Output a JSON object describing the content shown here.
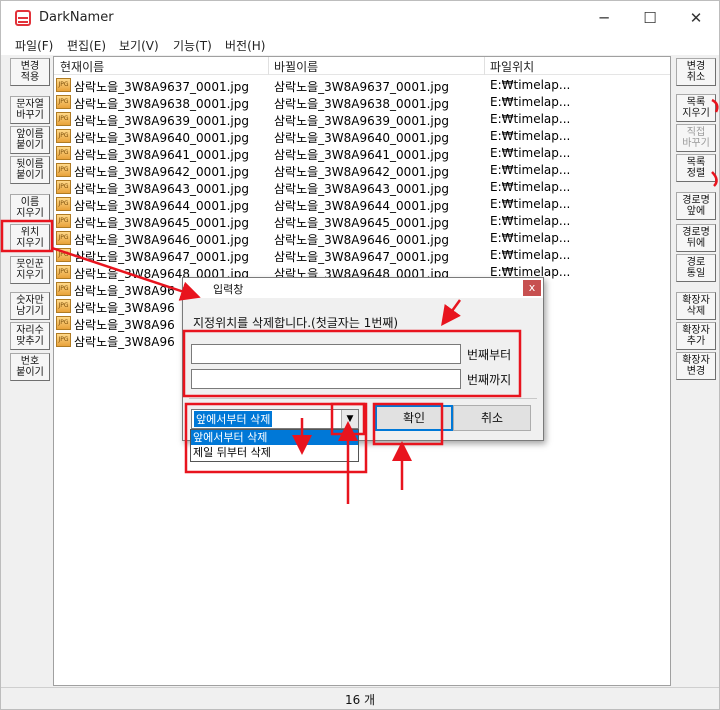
{
  "window": {
    "title": "DarkNamer",
    "controls": [
      "─",
      "☐",
      "✕"
    ]
  },
  "menu": [
    "파일(F)",
    "편집(E)",
    "보기(V)",
    "기능(T)",
    "버전(H)"
  ],
  "left_toolbar": [
    {
      "label": "변경\n적용"
    },
    {
      "label": "문자열\n바꾸기"
    },
    {
      "label": "앞이름\n붙이기"
    },
    {
      "label": "뒷이름\n붙이기"
    },
    {
      "label": "이름\n지우기"
    },
    {
      "label": "위치\n지우기"
    },
    {
      "label": "뭇인꾼\n지우기"
    },
    {
      "label": "숫자만\n남기기"
    },
    {
      "label": "자리수\n맞추기"
    },
    {
      "label": "번호\n붙이기"
    }
  ],
  "right_toolbar": [
    {
      "label": "변경\n취소"
    },
    {
      "label": "목록\n지우기"
    },
    {
      "label": "직접\n바꾸기"
    },
    {
      "label": "목록\n정렬"
    },
    {
      "label": "경로명\n앞에"
    },
    {
      "label": "경로명\n뒤에"
    },
    {
      "label": "경로\n통일"
    },
    {
      "label": "확장자\n삭제"
    },
    {
      "label": "확장자\n추가"
    },
    {
      "label": "확장자\n변경"
    }
  ],
  "list": {
    "columns": [
      "현재이름",
      "바뀔이름",
      "파일위치"
    ],
    "icon_text": "JPG",
    "rows": [
      {
        "current": "삼락노을_3W8A9637_0001.jpg",
        "new": "삼락노을_3W8A9637_0001.jpg",
        "path": "E:₩timelap..."
      },
      {
        "current": "삼락노을_3W8A9638_0001.jpg",
        "new": "삼락노을_3W8A9638_0001.jpg",
        "path": "E:₩timelap..."
      },
      {
        "current": "삼락노을_3W8A9639_0001.jpg",
        "new": "삼락노을_3W8A9639_0001.jpg",
        "path": "E:₩timelap..."
      },
      {
        "current": "삼락노을_3W8A9640_0001.jpg",
        "new": "삼락노을_3W8A9640_0001.jpg",
        "path": "E:₩timelap..."
      },
      {
        "current": "삼락노을_3W8A9641_0001.jpg",
        "new": "삼락노을_3W8A9641_0001.jpg",
        "path": "E:₩timelap..."
      },
      {
        "current": "삼락노을_3W8A9642_0001.jpg",
        "new": "삼락노을_3W8A9642_0001.jpg",
        "path": "E:₩timelap..."
      },
      {
        "current": "삼락노을_3W8A9643_0001.jpg",
        "new": "삼락노을_3W8A9643_0001.jpg",
        "path": "E:₩timelap..."
      },
      {
        "current": "삼락노을_3W8A9644_0001.jpg",
        "new": "삼락노을_3W8A9644_0001.jpg",
        "path": "E:₩timelap..."
      },
      {
        "current": "삼락노을_3W8A9645_0001.jpg",
        "new": "삼락노을_3W8A9645_0001.jpg",
        "path": "E:₩timelap..."
      },
      {
        "current": "삼락노을_3W8A9646_0001.jpg",
        "new": "삼락노을_3W8A9646_0001.jpg",
        "path": "E:₩timelap..."
      },
      {
        "current": "삼락노을_3W8A9647_0001.jpg",
        "new": "삼락노을_3W8A9647_0001.jpg",
        "path": "E:₩timelap..."
      },
      {
        "current": "삼락노을_3W8A9648_0001.jpg",
        "new": "삼락노을_3W8A9648_0001.jpg",
        "path": "E:₩timelap..."
      },
      {
        "current": "삼락노을_3W8A96",
        "new": "",
        "path": ""
      },
      {
        "current": "삼락노을_3W8A96",
        "new": "",
        "path": ""
      },
      {
        "current": "삼락노을_3W8A96",
        "new": "",
        "path": ""
      },
      {
        "current": "삼락노을_3W8A96",
        "new": "",
        "path": ""
      }
    ]
  },
  "status": {
    "count": "16 개"
  },
  "dialog": {
    "title": "입력창",
    "close": "x",
    "message": "지정위치를 삭제합니다.(첫글자는 1번째)",
    "from_value": "",
    "to_value": "",
    "from_label": "번째부터",
    "to_label": "번째까지",
    "mode_selected": "앞에서부터 삭제",
    "mode_options": [
      "앞에서부터 삭제",
      "제일 뒤부터 삭제"
    ],
    "ok_label": "확인",
    "cancel_label": "취소"
  },
  "annotation_color": "#e8141e"
}
